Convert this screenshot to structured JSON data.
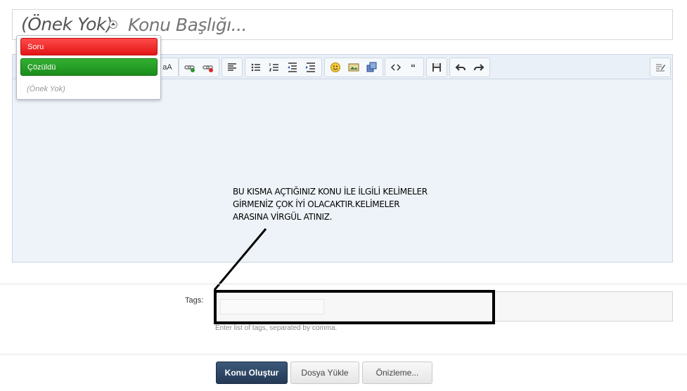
{
  "title_row": {
    "prefix_label": "(Önek Yok)",
    "title_placeholder": "Konu Başlığı..."
  },
  "prefix_dropdown": {
    "items": [
      {
        "label": "Soru",
        "color": "#e82020"
      },
      {
        "label": "Çözüldü",
        "color": "#22992a"
      },
      {
        "label": "(Önek Yok)",
        "color": "#999999"
      }
    ]
  },
  "toolbar": {
    "font_size_glyph": "aA",
    "buttons": [
      "font-size-icon",
      "link-icon",
      "unlink-icon",
      "align-left-icon",
      "bullet-list-icon",
      "numbered-list-icon",
      "outdent-icon",
      "indent-icon",
      "smiley-icon",
      "image-icon",
      "media-icon",
      "code-icon",
      "quote-icon",
      "save-icon",
      "undo-icon",
      "redo-icon",
      "toggle-source-icon"
    ]
  },
  "annotation": {
    "lines": [
      "BU KISMA AÇTIĞINIZ KONU İLE İLGİLİ KELİMELER",
      "GİRMENİZ ÇOK İYİ OLACAKTIR.KELİMELER",
      "ARASINA VİRGÜL ATINIZ."
    ]
  },
  "tags": {
    "label": "Tags:",
    "hint": "Enter list of tags, separated by comma.",
    "value": ""
  },
  "actions": {
    "create": "Konu Oluştur",
    "upload": "Dosya Yükle",
    "preview": "Önizleme..."
  }
}
